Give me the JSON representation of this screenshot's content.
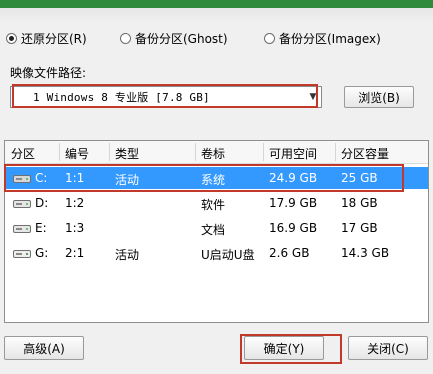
{
  "modes": [
    {
      "label": "还原分区(R)",
      "checked": true
    },
    {
      "label": "备份分区(Ghost)",
      "checked": false
    },
    {
      "label": "备份分区(Imagex)",
      "checked": false
    }
  ],
  "image_path_label": "映像文件路径:",
  "image_select_value": "1 Windows 8 专业版 [7.8 GB]",
  "browse_button": "浏览(B)",
  "columns": [
    "分区",
    "编号",
    "类型",
    "卷标",
    "可用空间",
    "分区容量"
  ],
  "rows": [
    {
      "drive": "C:",
      "num": "1:1",
      "type": "活动",
      "label": "系统",
      "free": "24.9 GB",
      "size": "25 GB",
      "selected": true
    },
    {
      "drive": "D:",
      "num": "1:2",
      "type": "",
      "label": "软件",
      "free": "17.9 GB",
      "size": "18 GB",
      "selected": false
    },
    {
      "drive": "E:",
      "num": "1:3",
      "type": "",
      "label": "文档",
      "free": "16.9 GB",
      "size": "17 GB",
      "selected": false
    },
    {
      "drive": "G:",
      "num": "2:1",
      "type": "活动",
      "label": "U启动U盘",
      "free": "2.6 GB",
      "size": "14.3 GB",
      "selected": false
    }
  ],
  "advanced_button": "高级(A)",
  "ok_button": "确定(Y)",
  "close_button": "关闭(C)",
  "colors": {
    "selection": "#3399ff",
    "highlight_box": "#c0392b"
  }
}
